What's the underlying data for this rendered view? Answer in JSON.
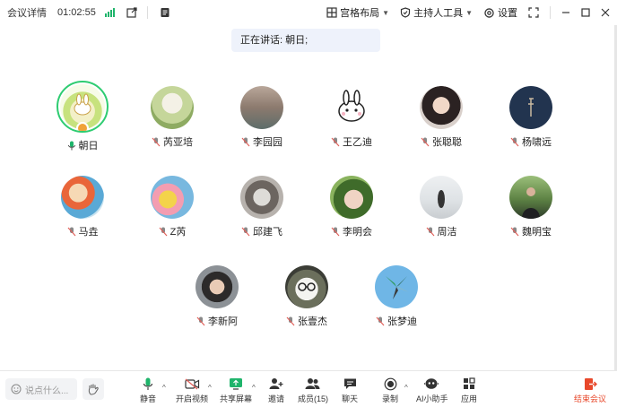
{
  "topbar": {
    "meeting_info": "会议详情",
    "timer": "01:02:55",
    "layout_label": "宫格布局",
    "host_tools_label": "主持人工具",
    "settings_label": "设置"
  },
  "speaking_banner": "正在讲话: 朝日;",
  "participants": [
    {
      "name": "朝日"
    },
    {
      "name": "芮亚培"
    },
    {
      "name": "李园园"
    },
    {
      "name": "王乙迪"
    },
    {
      "name": "张聪聪"
    },
    {
      "name": "杨啸远"
    },
    {
      "name": "马垚"
    },
    {
      "name": "Z芮"
    },
    {
      "name": "邱建飞"
    },
    {
      "name": "李明会"
    },
    {
      "name": "周洁"
    },
    {
      "name": "魏明宝"
    },
    {
      "name": "李新阿"
    },
    {
      "name": "张壹杰"
    },
    {
      "name": "张梦迪"
    }
  ],
  "bottombar": {
    "say_placeholder": "说点什么...",
    "mute": "静音",
    "video": "开启视频",
    "share": "共享屏幕",
    "invite": "邀请",
    "members": "成员(15)",
    "chat": "聊天",
    "record": "录制",
    "ai": "AI小助手",
    "apps": "应用",
    "end": "结束会议"
  },
  "colors": {
    "accent_green": "#1fb46b",
    "muted_mic": "#e0615b",
    "end_red": "#e8482b",
    "banner_bg": "#eef2fb"
  }
}
